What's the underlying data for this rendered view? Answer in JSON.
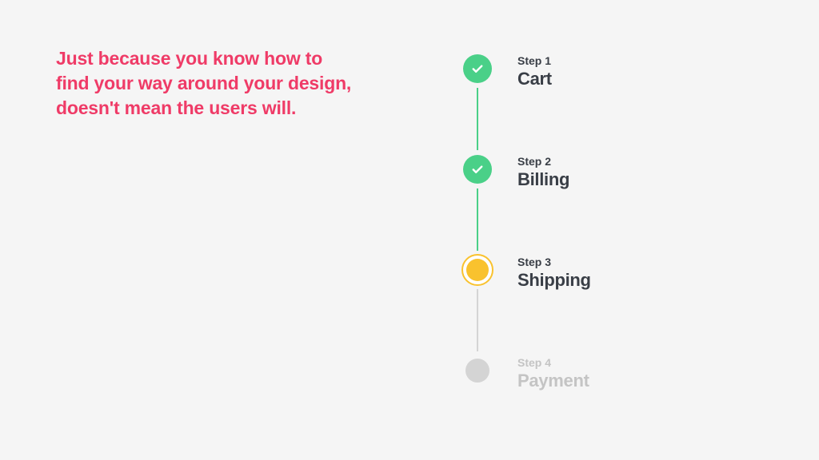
{
  "quote": "Just because you know how to find your way around your design, doesn't mean the users will.",
  "colors": {
    "accent": "#ef3b67",
    "completed": "#4ad088",
    "current": "#f9c22e",
    "upcoming": "#d4d4d4",
    "text": "#393e46"
  },
  "stepper": {
    "steps": [
      {
        "label": "Step 1",
        "title": "Cart",
        "state": "completed"
      },
      {
        "label": "Step 2",
        "title": "Billing",
        "state": "completed"
      },
      {
        "label": "Step 3",
        "title": "Shipping",
        "state": "current"
      },
      {
        "label": "Step 4",
        "title": "Payment",
        "state": "upcoming"
      }
    ]
  }
}
